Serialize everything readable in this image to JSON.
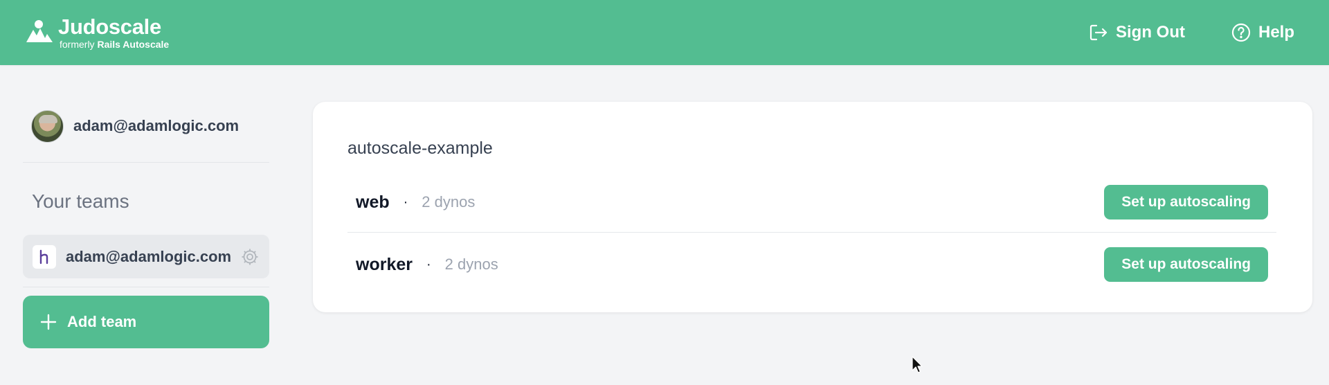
{
  "header": {
    "brand_name": "Judoscale",
    "brand_sub_prefix": "formerly",
    "brand_sub_name": "Rails Autoscale",
    "sign_out_label": "Sign Out",
    "help_label": "Help"
  },
  "sidebar": {
    "user_email": "adam@adamlogic.com",
    "teams_heading": "Your teams",
    "teams": [
      {
        "name": "adam@adamlogic.com",
        "icon": "heroku-icon"
      }
    ],
    "add_team_label": "Add team"
  },
  "main": {
    "app_name": "autoscale-example",
    "processes": [
      {
        "name": "web",
        "separator": "·",
        "dynos": "2 dynos",
        "action_label": "Set up autoscaling"
      },
      {
        "name": "worker",
        "separator": "·",
        "dynos": "2 dynos",
        "action_label": "Set up autoscaling"
      }
    ]
  },
  "colors": {
    "brand": "#53bd91",
    "background": "#f3f4f6",
    "card": "#ffffff"
  }
}
